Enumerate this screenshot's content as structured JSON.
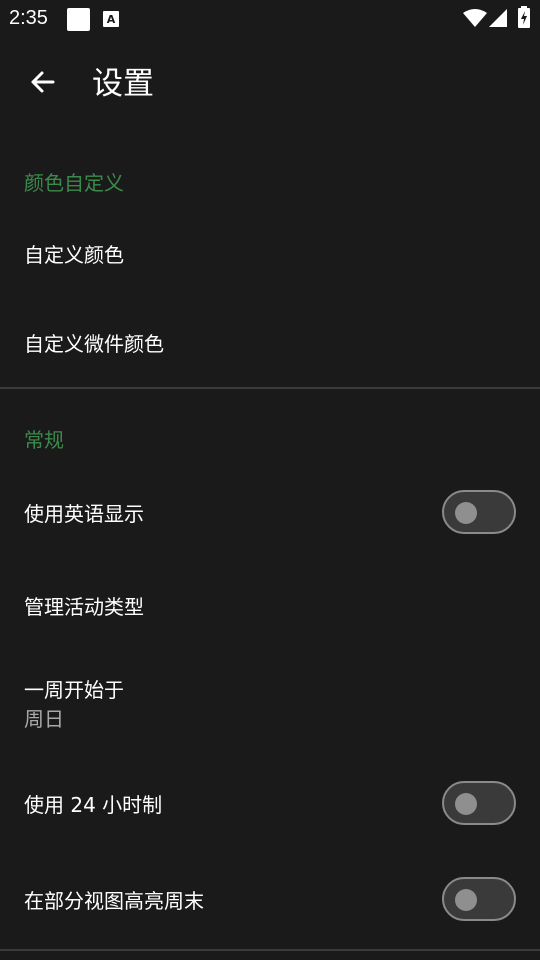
{
  "status_bar": {
    "time": "2:35",
    "icons": [
      "notification-square-icon",
      "accessibility-a-icon",
      "wifi-icon",
      "cell-signal-icon",
      "battery-charging-icon"
    ]
  },
  "app_bar": {
    "title": "设置",
    "back_icon": "arrow-left-icon"
  },
  "sections": {
    "color": {
      "header": "颜色自定义",
      "items": [
        {
          "title": "自定义颜色"
        },
        {
          "title": "自定义微件颜色"
        }
      ]
    },
    "general": {
      "header": "常规",
      "items": [
        {
          "title": "使用英语显示",
          "toggle": false
        },
        {
          "title": "管理活动类型"
        },
        {
          "title": "一周开始于",
          "summary": "周日"
        },
        {
          "title": "使用 24 小时制",
          "toggle": false
        },
        {
          "title": "在部分视图高亮周末",
          "toggle": false
        }
      ]
    }
  },
  "colors": {
    "background": "#1b1a1b",
    "accent": "#3b8a4b",
    "divider": "#3a3a3a",
    "secondary_text": "#a8a8a8"
  }
}
